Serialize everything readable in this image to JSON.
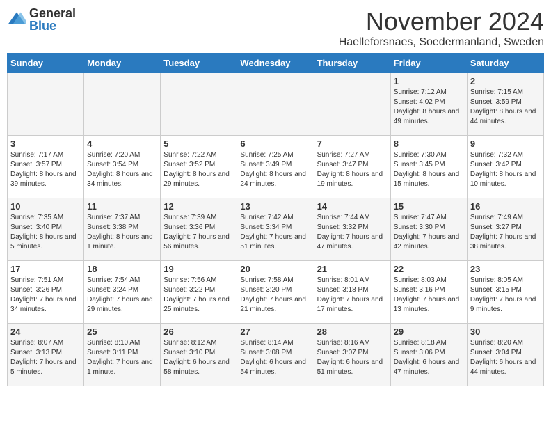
{
  "logo": {
    "general": "General",
    "blue": "Blue"
  },
  "title": "November 2024",
  "subtitle": "Haelleforsnaes, Soedermanland, Sweden",
  "days_of_week": [
    "Sunday",
    "Monday",
    "Tuesday",
    "Wednesday",
    "Thursday",
    "Friday",
    "Saturday"
  ],
  "weeks": [
    [
      {
        "day": "",
        "info": ""
      },
      {
        "day": "",
        "info": ""
      },
      {
        "day": "",
        "info": ""
      },
      {
        "day": "",
        "info": ""
      },
      {
        "day": "",
        "info": ""
      },
      {
        "day": "1",
        "info": "Sunrise: 7:12 AM\nSunset: 4:02 PM\nDaylight: 8 hours and 49 minutes."
      },
      {
        "day": "2",
        "info": "Sunrise: 7:15 AM\nSunset: 3:59 PM\nDaylight: 8 hours and 44 minutes."
      }
    ],
    [
      {
        "day": "3",
        "info": "Sunrise: 7:17 AM\nSunset: 3:57 PM\nDaylight: 8 hours and 39 minutes."
      },
      {
        "day": "4",
        "info": "Sunrise: 7:20 AM\nSunset: 3:54 PM\nDaylight: 8 hours and 34 minutes."
      },
      {
        "day": "5",
        "info": "Sunrise: 7:22 AM\nSunset: 3:52 PM\nDaylight: 8 hours and 29 minutes."
      },
      {
        "day": "6",
        "info": "Sunrise: 7:25 AM\nSunset: 3:49 PM\nDaylight: 8 hours and 24 minutes."
      },
      {
        "day": "7",
        "info": "Sunrise: 7:27 AM\nSunset: 3:47 PM\nDaylight: 8 hours and 19 minutes."
      },
      {
        "day": "8",
        "info": "Sunrise: 7:30 AM\nSunset: 3:45 PM\nDaylight: 8 hours and 15 minutes."
      },
      {
        "day": "9",
        "info": "Sunrise: 7:32 AM\nSunset: 3:42 PM\nDaylight: 8 hours and 10 minutes."
      }
    ],
    [
      {
        "day": "10",
        "info": "Sunrise: 7:35 AM\nSunset: 3:40 PM\nDaylight: 8 hours and 5 minutes."
      },
      {
        "day": "11",
        "info": "Sunrise: 7:37 AM\nSunset: 3:38 PM\nDaylight: 8 hours and 1 minute."
      },
      {
        "day": "12",
        "info": "Sunrise: 7:39 AM\nSunset: 3:36 PM\nDaylight: 7 hours and 56 minutes."
      },
      {
        "day": "13",
        "info": "Sunrise: 7:42 AM\nSunset: 3:34 PM\nDaylight: 7 hours and 51 minutes."
      },
      {
        "day": "14",
        "info": "Sunrise: 7:44 AM\nSunset: 3:32 PM\nDaylight: 7 hours and 47 minutes."
      },
      {
        "day": "15",
        "info": "Sunrise: 7:47 AM\nSunset: 3:30 PM\nDaylight: 7 hours and 42 minutes."
      },
      {
        "day": "16",
        "info": "Sunrise: 7:49 AM\nSunset: 3:27 PM\nDaylight: 7 hours and 38 minutes."
      }
    ],
    [
      {
        "day": "17",
        "info": "Sunrise: 7:51 AM\nSunset: 3:26 PM\nDaylight: 7 hours and 34 minutes."
      },
      {
        "day": "18",
        "info": "Sunrise: 7:54 AM\nSunset: 3:24 PM\nDaylight: 7 hours and 29 minutes."
      },
      {
        "day": "19",
        "info": "Sunrise: 7:56 AM\nSunset: 3:22 PM\nDaylight: 7 hours and 25 minutes."
      },
      {
        "day": "20",
        "info": "Sunrise: 7:58 AM\nSunset: 3:20 PM\nDaylight: 7 hours and 21 minutes."
      },
      {
        "day": "21",
        "info": "Sunrise: 8:01 AM\nSunset: 3:18 PM\nDaylight: 7 hours and 17 minutes."
      },
      {
        "day": "22",
        "info": "Sunrise: 8:03 AM\nSunset: 3:16 PM\nDaylight: 7 hours and 13 minutes."
      },
      {
        "day": "23",
        "info": "Sunrise: 8:05 AM\nSunset: 3:15 PM\nDaylight: 7 hours and 9 minutes."
      }
    ],
    [
      {
        "day": "24",
        "info": "Sunrise: 8:07 AM\nSunset: 3:13 PM\nDaylight: 7 hours and 5 minutes."
      },
      {
        "day": "25",
        "info": "Sunrise: 8:10 AM\nSunset: 3:11 PM\nDaylight: 7 hours and 1 minute."
      },
      {
        "day": "26",
        "info": "Sunrise: 8:12 AM\nSunset: 3:10 PM\nDaylight: 6 hours and 58 minutes."
      },
      {
        "day": "27",
        "info": "Sunrise: 8:14 AM\nSunset: 3:08 PM\nDaylight: 6 hours and 54 minutes."
      },
      {
        "day": "28",
        "info": "Sunrise: 8:16 AM\nSunset: 3:07 PM\nDaylight: 6 hours and 51 minutes."
      },
      {
        "day": "29",
        "info": "Sunrise: 8:18 AM\nSunset: 3:06 PM\nDaylight: 6 hours and 47 minutes."
      },
      {
        "day": "30",
        "info": "Sunrise: 8:20 AM\nSunset: 3:04 PM\nDaylight: 6 hours and 44 minutes."
      }
    ]
  ]
}
